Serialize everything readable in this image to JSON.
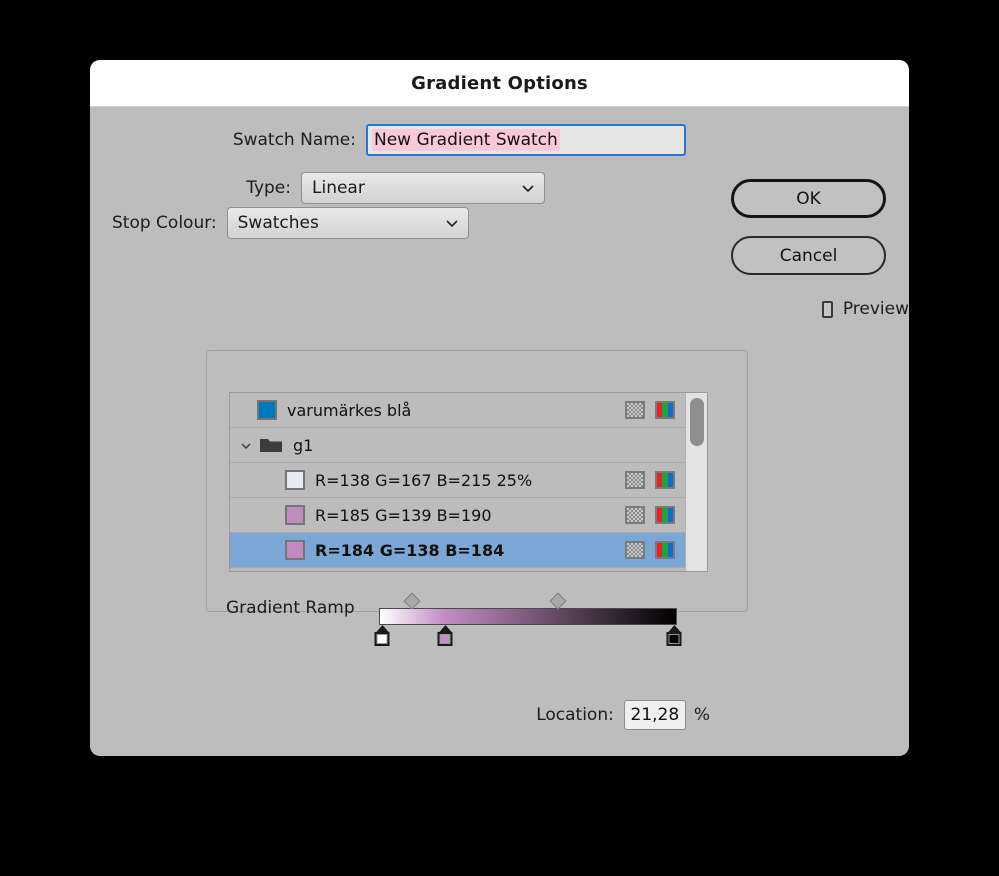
{
  "dialog": {
    "title": "Gradient Options"
  },
  "form": {
    "swatch_name_label": "Swatch Name:",
    "swatch_name_value": "New Gradient Swatch",
    "swatch_name_selected": true,
    "type_label": "Type:",
    "type_value": "Linear",
    "stop_colour_label": "Stop Colour:",
    "stop_colour_value": "Swatches"
  },
  "swatch_list": {
    "rows": [
      {
        "kind": "swatch",
        "label": "varumärkes blå",
        "chip_color": "#0078be",
        "indent": false,
        "selected": false,
        "icons": [
          "process-dots-icon",
          "rgb-stripes-icon"
        ]
      },
      {
        "kind": "folder",
        "label": "g1",
        "indent": false,
        "selected": false,
        "expanded": true,
        "icons": []
      },
      {
        "kind": "swatch",
        "label": "R=138 G=167 B=215 25%",
        "chip_color": "#e4e9f4",
        "indent": true,
        "selected": false,
        "icons": [
          "process-dots-icon",
          "rgb-stripes-icon"
        ]
      },
      {
        "kind": "swatch",
        "label": "R=185 G=139 B=190",
        "chip_color": "#c08cc0",
        "indent": true,
        "selected": false,
        "icons": [
          "process-dots-icon",
          "rgb-stripes-icon"
        ]
      },
      {
        "kind": "swatch",
        "label": "R=184 G=138 B=184",
        "chip_color": "#c08ac0",
        "indent": true,
        "selected": true,
        "icons": [
          "process-dots-icon",
          "rgb-stripes-icon"
        ]
      }
    ],
    "scrollbar": {
      "thumb_top_pct": 3,
      "thumb_height_pct": 27
    }
  },
  "gradient": {
    "ramp_label": "Gradient Ramp",
    "stops": [
      {
        "location_pct": 0,
        "color": "#ffffff"
      },
      {
        "location_pct": 21.28,
        "color": "#c48fc4"
      },
      {
        "location_pct": 100,
        "color": "#000000"
      }
    ],
    "midpoints_pct": [
      10.5,
      60
    ],
    "location_label": "Location:",
    "location_value": "21,28",
    "location_unit": "%"
  },
  "buttons": {
    "ok_label": "OK",
    "cancel_label": "Cancel",
    "preview_label": "Preview",
    "preview_checked": false
  },
  "colors": {
    "dialog_bg": "#bdbdbd",
    "titlebar_bg": "#ffffff",
    "selection_blue": "#7ba7d7",
    "focus_blue": "#2a74d4",
    "text_selection_pink": "#fbc8d8"
  }
}
